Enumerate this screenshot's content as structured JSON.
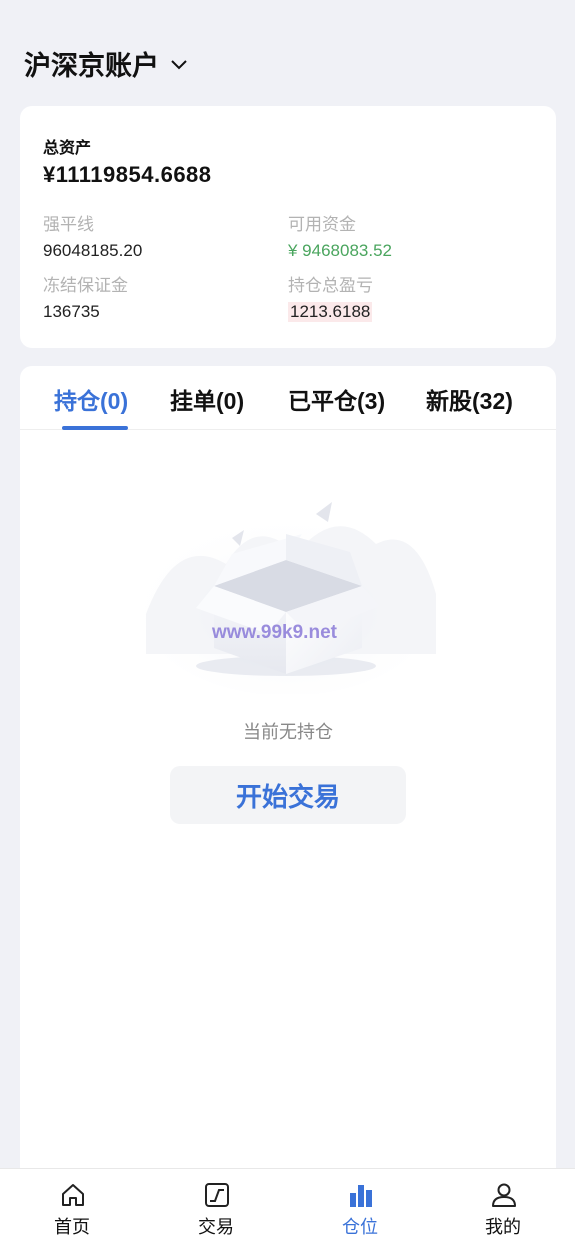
{
  "header": {
    "title": "沪深京账户",
    "icon": "chevron-down-icon"
  },
  "assets": {
    "total_label": "总资产",
    "total_value": "¥11119854.6688",
    "stats": [
      {
        "label": "强平线",
        "value": "96048185.20"
      },
      {
        "label": "可用资金",
        "value": "¥ 9468083.52"
      },
      {
        "label": "冻结保证金",
        "value": "136735"
      },
      {
        "label": "持仓总盈亏",
        "value": "1213.6188"
      }
    ]
  },
  "tabs": [
    {
      "label": "持仓(0)",
      "active": true
    },
    {
      "label": "挂单(0)"
    },
    {
      "label": "已平仓(3)"
    },
    {
      "label": "新股(32)"
    }
  ],
  "empty": {
    "watermark": "www.99k9.net",
    "message": "当前无持仓",
    "button": "开始交易"
  },
  "tabbar": [
    {
      "label": "首页",
      "icon": "home-icon"
    },
    {
      "label": "交易",
      "icon": "trade-chart-icon"
    },
    {
      "label": "仓位",
      "icon": "position-bars-icon",
      "active": true
    },
    {
      "label": "我的",
      "icon": "user-icon"
    }
  ],
  "colors": {
    "accent": "#3a72d8",
    "green": "#4aa55e",
    "loss_bg": "#fbe9ea"
  }
}
